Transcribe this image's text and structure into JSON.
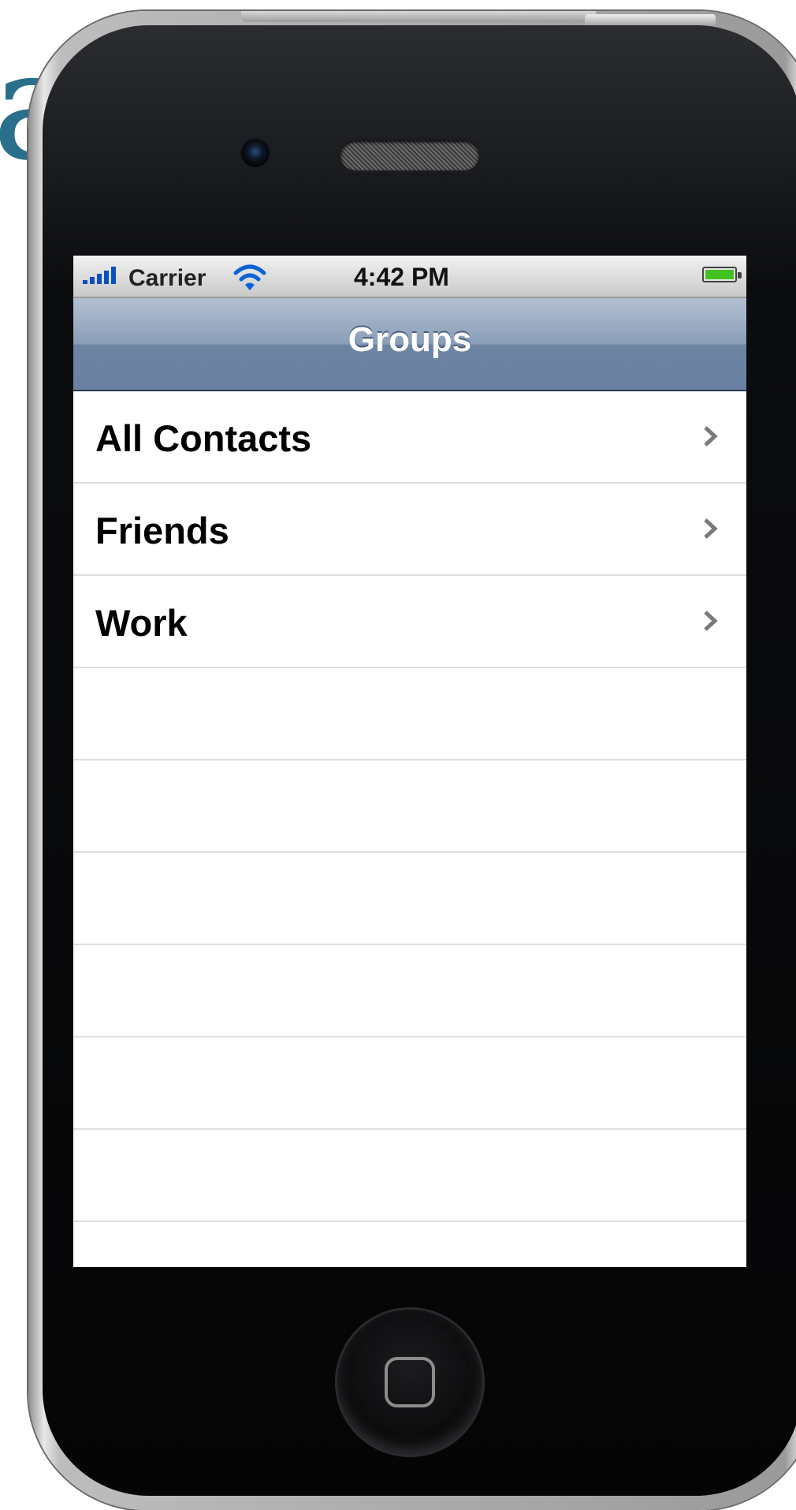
{
  "background": {
    "glyphs": "ai"
  },
  "status_bar": {
    "carrier": "Carrier",
    "time": "4:42 PM",
    "signal_icon": "signal-bars-icon",
    "wifi_icon": "wifi-icon",
    "battery_icon": "battery-icon",
    "battery_level": 1.0
  },
  "nav_bar": {
    "title": "Groups"
  },
  "groups": [
    {
      "label": "All Contacts"
    },
    {
      "label": "Friends"
    },
    {
      "label": "Work"
    }
  ],
  "colors": {
    "signal": "#0a4fbf",
    "battery": "#43c21f",
    "nav_gradient_top": "#b3c0d2",
    "nav_gradient_bottom": "#6a80a0",
    "background_glyph": "#2a6f8c"
  }
}
